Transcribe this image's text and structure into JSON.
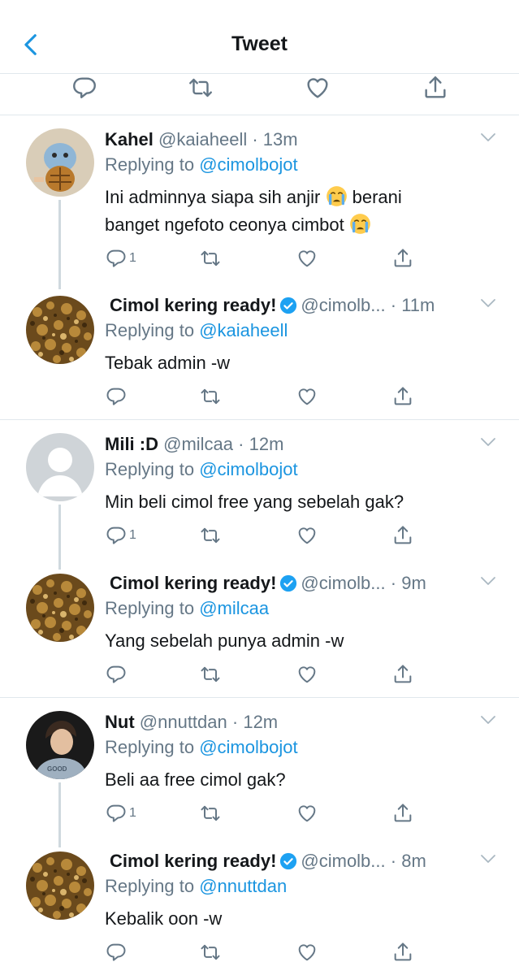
{
  "header": {
    "title": "Tweet",
    "back_icon": "chevron-left-icon"
  },
  "colors": {
    "accent": "#1b95e0",
    "muted": "#657786",
    "text": "#14171a",
    "divider": "#e1e8ed"
  },
  "tweets": [
    {
      "name": "Kahel",
      "handle": "@kaiaheell",
      "time": "· 13m",
      "replying_prefix": "Replying to",
      "replying_to": "@cimolbojot",
      "text_line1": "Ini adminnya siapa sih anjir",
      "text_line2": "berani",
      "text_line3": "banget ngefoto ceonya cimbot",
      "reply_count": "1"
    },
    {
      "name": "Cimol kering ready!",
      "handle": "@cimolb...",
      "time": "· 11m",
      "replying_prefix": "Replying to",
      "replying_to": "@kaiaheell",
      "text": "Tebak admin -w"
    },
    {
      "name": "Mili :D",
      "handle": "@milcaa",
      "time": "· 12m",
      "replying_prefix": "Replying to",
      "replying_to": "@cimolbojot",
      "text": "Min beli cimol free yang sebelah gak?",
      "reply_count": "1"
    },
    {
      "name": "Cimol kering ready!",
      "handle": "@cimolb...",
      "time": "· 9m",
      "replying_prefix": "Replying to",
      "replying_to": "@milcaa",
      "text": "Yang sebelah punya admin -w"
    },
    {
      "name": "Nut",
      "handle": "@nnuttdan",
      "time": "· 12m",
      "replying_prefix": "Replying to",
      "replying_to": "@cimolbojot",
      "text": "Beli aa free cimol gak?",
      "reply_count": "1"
    },
    {
      "name": "Cimol kering ready!",
      "handle": "@cimolb...",
      "time": "· 8m",
      "replying_prefix": "Replying to",
      "replying_to": "@nnuttdan",
      "text": "Kebalik oon -w"
    }
  ]
}
